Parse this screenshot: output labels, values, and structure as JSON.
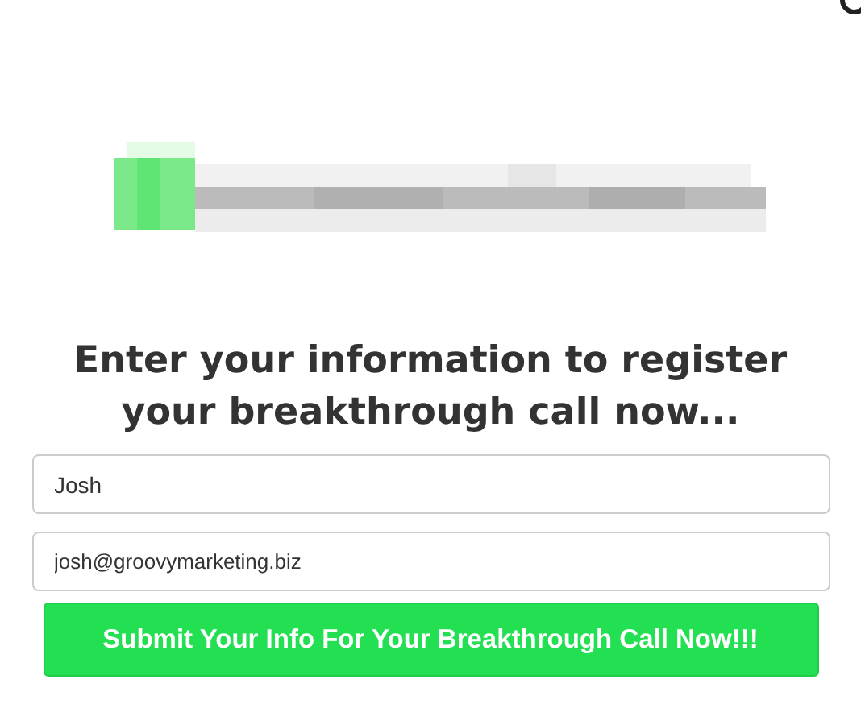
{
  "heading": "Enter your information to register your breakthrough call now...",
  "fields": [
    {
      "value": "Josh"
    },
    {
      "value": "josh@groovymarketing.biz"
    }
  ],
  "submit_button": "Submit Your Info For Your Breakthrough Call Now!!!"
}
